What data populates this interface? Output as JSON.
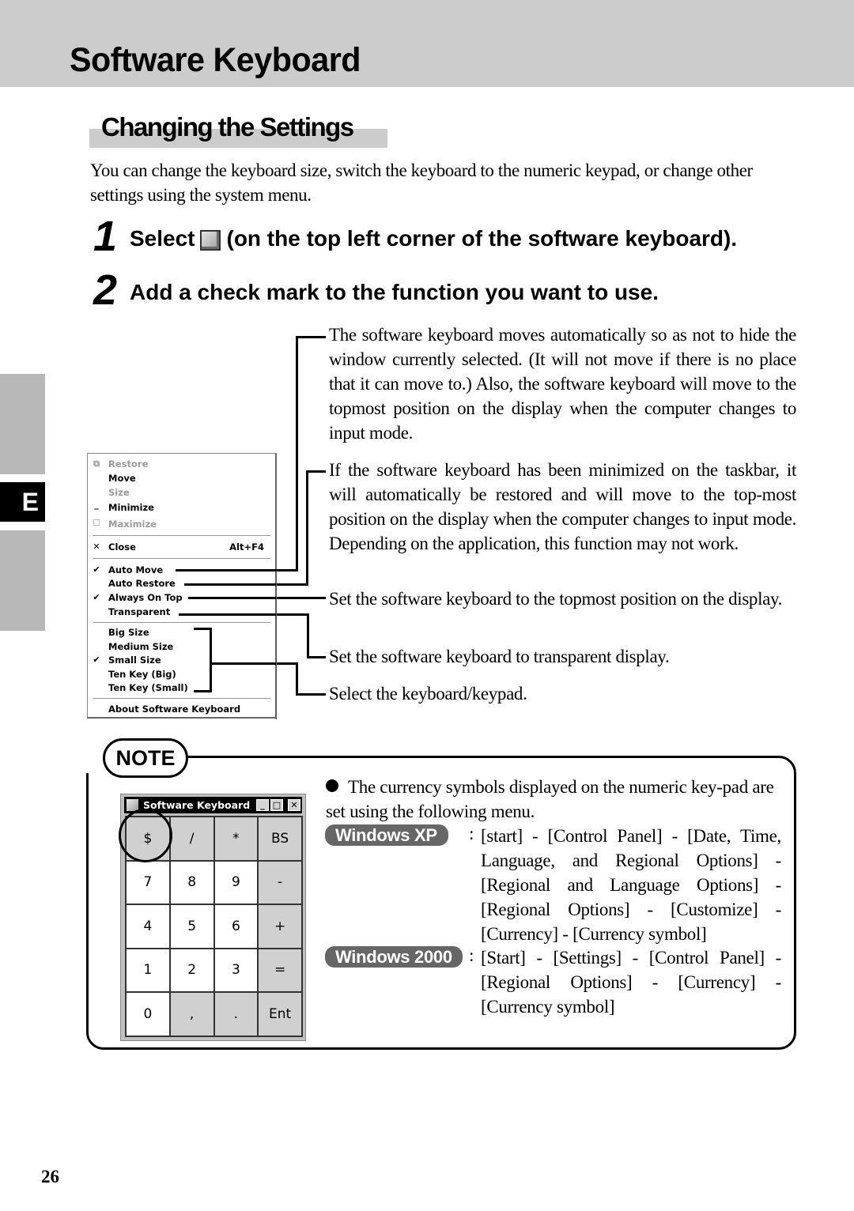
{
  "header": {
    "title": "Software Keyboard"
  },
  "section": {
    "title": "Changing the Settings"
  },
  "intro": "You can change the keyboard size, switch the keyboard to the numeric keypad, or change other settings using the system menu.",
  "steps": [
    {
      "number": "1",
      "text_before": "Select",
      "icon": "system-menu-icon",
      "text_after": "(on the top left corner of the software keyboard)."
    },
    {
      "number": "2",
      "text": "Add a check mark to the function you want to use."
    }
  ],
  "side_tab": {
    "letter": "E"
  },
  "system_menu": {
    "items": [
      {
        "label": "Restore",
        "icon": "restore-icon",
        "glyph": "⧉",
        "disabled": true
      },
      {
        "label": "Move",
        "disabled": false
      },
      {
        "label": "Size",
        "disabled": true
      },
      {
        "label": "Minimize",
        "icon": "minimize-icon",
        "glyph": "_",
        "disabled": false
      },
      {
        "label": "Maximize",
        "icon": "maximize-icon",
        "glyph": "☐",
        "disabled": true
      },
      {
        "label": "Close",
        "icon": "close-icon",
        "glyph": "✕",
        "shortcut": "Alt+F4",
        "disabled": false
      },
      {
        "label": "Auto Move",
        "checked": true
      },
      {
        "label": "Auto Restore",
        "checked": false
      },
      {
        "label": "Always On Top",
        "checked": true
      },
      {
        "label": "Transparent",
        "checked": false
      },
      {
        "label": "Big Size",
        "checked": false
      },
      {
        "label": "Medium Size",
        "checked": false
      },
      {
        "label": "Small Size",
        "checked": true
      },
      {
        "label": "Ten Key (Big)",
        "checked": false
      },
      {
        "label": "Ten Key (Small)",
        "checked": false
      },
      {
        "label": "About Software Keyboard"
      }
    ],
    "check_glyph": "✔"
  },
  "descriptions": {
    "auto_move": "The software keyboard moves automatically so as not to hide the window currently selected. (It will not move if there is no place that it can move to.)  Also, the software keyboard will move to the topmost position on the display when the computer changes to input mode.",
    "auto_restore": "If the software keyboard has been minimized on the taskbar, it will automatically be restored and will move to the top-most position on the display when the computer changes to input mode.  Depending on the application, this function may not work.",
    "always_on_top": "Set the software keyboard to the topmost position on the display.",
    "transparent": "Set the software keyboard to transparent display.",
    "size": "Select the keyboard/keypad."
  },
  "note": {
    "label": "NOTE",
    "keyboard_window": {
      "title": "Software Keyboard",
      "buttons": [
        "_",
        "□",
        "✕"
      ],
      "keys": [
        "$",
        "/",
        "*",
        "BS",
        "7",
        "8",
        "9",
        "-",
        "4",
        "5",
        "6",
        "+",
        "1",
        "2",
        "3",
        "=",
        "0",
        ",",
        ".",
        "Ent"
      ],
      "highlighted_key": "$"
    },
    "bullet": "The currency symbols displayed on the numeric key-pad are set using the following menu.",
    "os_paths": [
      {
        "os": "Windows XP",
        "path": "[start] - [Control Panel] - [Date, Time, Language, and Regional Options] - [Regional and Language Options] - [Regional Options] - [Customize] - [Currency] - [Currency symbol]"
      },
      {
        "os": "Windows 2000",
        "path": "[Start] - [Settings] - [Control Panel] - [Regional Options] - [Currency] - [Currency symbol]"
      }
    ],
    "colon": ":"
  },
  "page_number": "26"
}
